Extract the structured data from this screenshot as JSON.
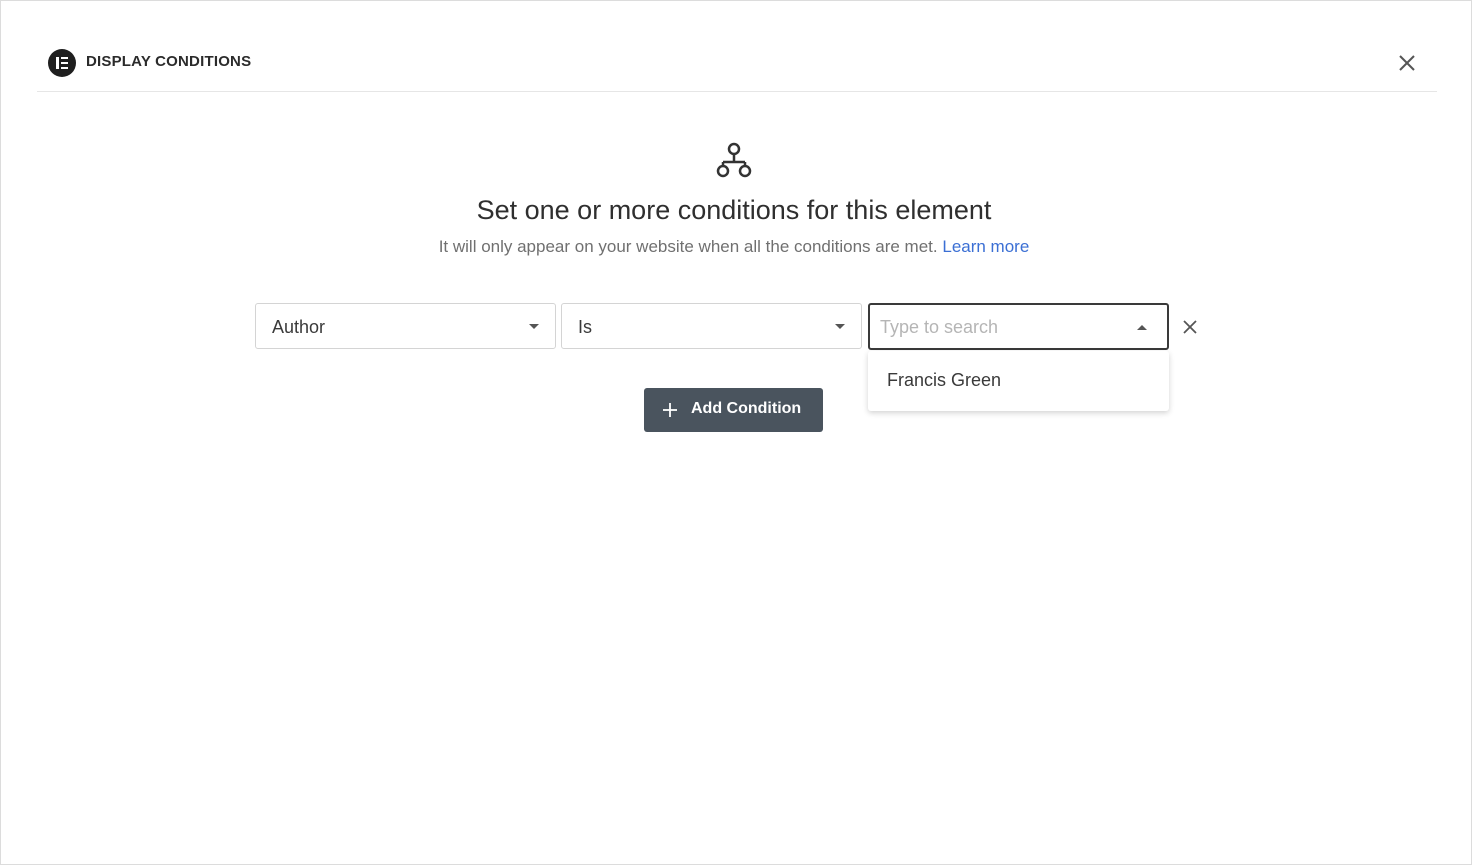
{
  "header": {
    "title": "DISPLAY CONDITIONS",
    "logo_icon": "elementor-logo-icon",
    "close_icon": "close-icon"
  },
  "intro": {
    "icon": "sitemap-icon",
    "heading": "Set one or more conditions for this element",
    "description": "It will only appear on your website when all the conditions are met.",
    "learn_more_label": "Learn more"
  },
  "condition_row": {
    "field_select": {
      "value": "Author"
    },
    "operator_select": {
      "value": "Is"
    },
    "value_search": {
      "placeholder": "Type to search",
      "value": "",
      "open": true,
      "options": [
        "Francis Green"
      ]
    },
    "remove_icon": "close-icon"
  },
  "actions": {
    "add_condition_label": "Add Condition",
    "add_icon": "plus-icon"
  },
  "colors": {
    "button_bg": "#4a545e",
    "link": "#3b6fd4",
    "text": "#2f2f2f"
  }
}
